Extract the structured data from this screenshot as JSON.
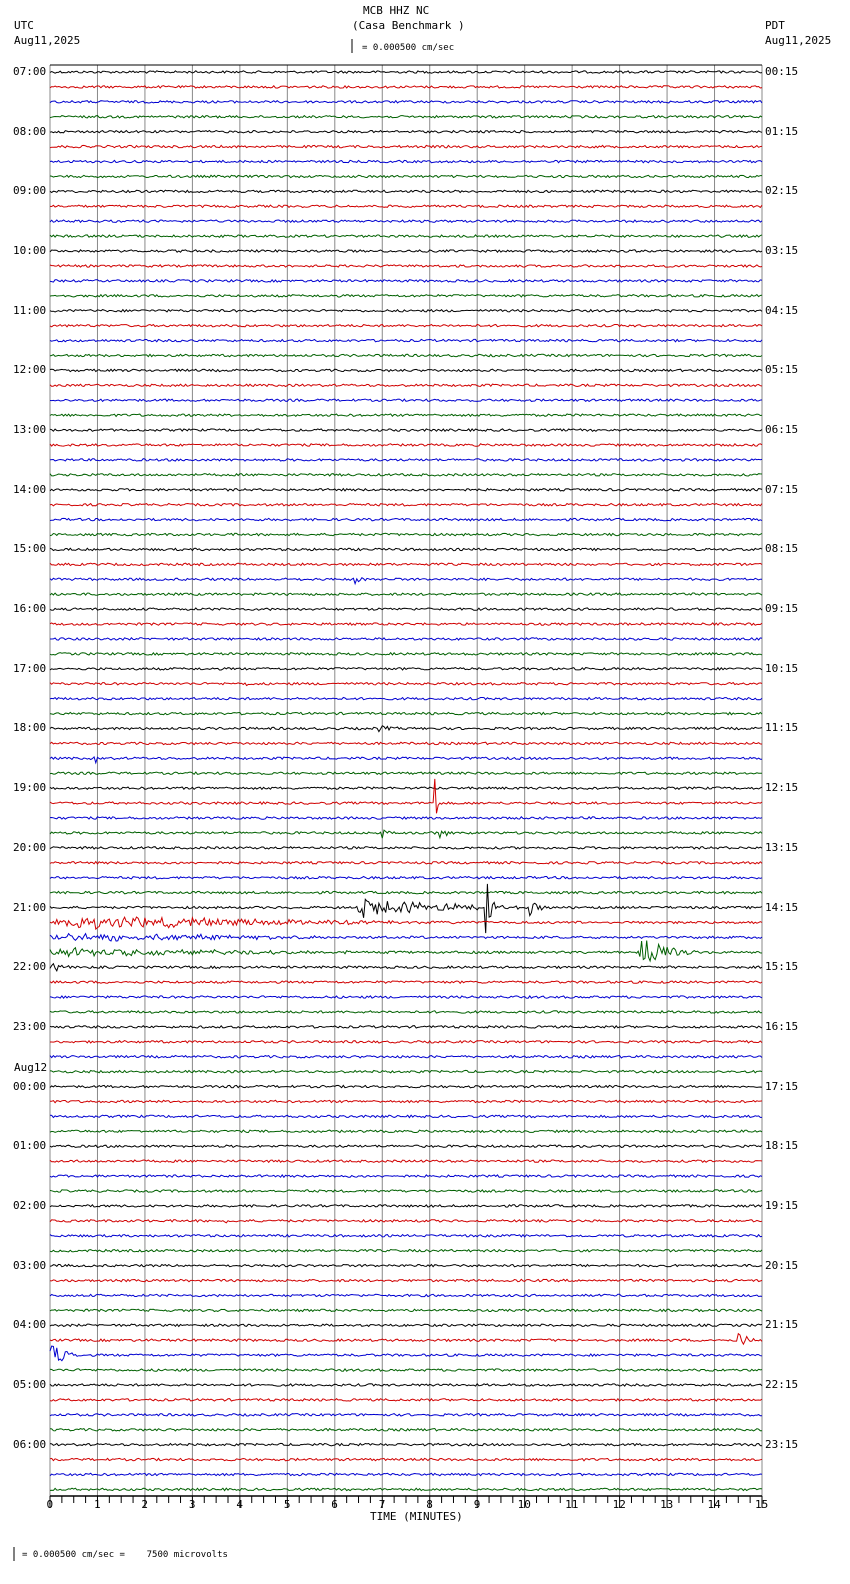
{
  "header": {
    "station": "MCB HHZ NC",
    "site": "(Casa Benchmark )",
    "scale": "= 0.000500 cm/sec",
    "left_tz": "UTC",
    "left_date": "Aug11,2025",
    "right_tz": "PDT",
    "right_date": "Aug11,2025",
    "date_change": "Aug12"
  },
  "footer": {
    "scale": "= 0.000500 cm/sec =    7500 microvolts"
  },
  "chart_data": {
    "type": "line",
    "title": "MCB HHZ NC (Casa Benchmark )",
    "xlabel": "TIME (MINUTES)",
    "xlim": [
      0,
      15
    ],
    "x_ticks": [
      "0",
      "1",
      "2",
      "3",
      "4",
      "5",
      "6",
      "7",
      "8",
      "9",
      "10",
      "11",
      "12",
      "13",
      "14",
      "15"
    ],
    "rows_per_hour": 4,
    "row_count": 96,
    "trace_colors": [
      "#000000",
      "#d00000",
      "#0000d0",
      "#006000"
    ],
    "utc_labels": [
      "07:00",
      "08:00",
      "09:00",
      "10:00",
      "11:00",
      "12:00",
      "13:00",
      "14:00",
      "15:00",
      "16:00",
      "17:00",
      "18:00",
      "19:00",
      "20:00",
      "21:00",
      "22:00",
      "23:00",
      "00:00",
      "01:00",
      "02:00",
      "03:00",
      "04:00",
      "05:00",
      "06:00"
    ],
    "pdt_labels": [
      "00:15",
      "01:15",
      "02:15",
      "03:15",
      "04:15",
      "05:15",
      "06:15",
      "07:15",
      "08:15",
      "09:15",
      "10:15",
      "11:15",
      "12:15",
      "13:15",
      "14:15",
      "15:15",
      "16:15",
      "17:15",
      "18:15",
      "19:15",
      "20:15",
      "21:15",
      "22:15",
      "23:15"
    ],
    "events": [
      {
        "row": 34,
        "start": 6.4,
        "end": 6.8,
        "amp": 0.9
      },
      {
        "row": 41,
        "start": 4.1,
        "end": 4.4,
        "amp": 0.3
      },
      {
        "row": 44,
        "start": 6.9,
        "end": 8.2,
        "amp": 0.3
      },
      {
        "row": 46,
        "start": 0.9,
        "end": 1.2,
        "amp": 0.7
      },
      {
        "row": 49,
        "start": 8.1,
        "end": 8.2,
        "amp": 5.5
      },
      {
        "row": 51,
        "start": 7.0,
        "end": 7.3,
        "amp": 0.6
      },
      {
        "row": 51,
        "start": 8.2,
        "end": 8.6,
        "amp": 0.8
      },
      {
        "row": 56,
        "start": 6.5,
        "end": 12.3,
        "amp": 0.8
      },
      {
        "row": 56,
        "start": 9.15,
        "end": 9.4,
        "amp": 5.0
      },
      {
        "row": 56,
        "start": 10.1,
        "end": 10.6,
        "amp": 1.2
      },
      {
        "row": 57,
        "start": 0.1,
        "end": 15,
        "amp": 0.6
      },
      {
        "row": 58,
        "start": 0,
        "end": 15,
        "amp": 0.4
      },
      {
        "row": 59,
        "start": 0,
        "end": 15,
        "amp": 0.4
      },
      {
        "row": 59,
        "start": 12.4,
        "end": 13.9,
        "amp": 2.0
      },
      {
        "row": 60,
        "start": 0,
        "end": 1.0,
        "amp": 0.4
      },
      {
        "row": 77,
        "start": 3.7,
        "end": 3.9,
        "amp": 0.3
      },
      {
        "row": 85,
        "start": 10.3,
        "end": 10.5,
        "amp": 0.5
      },
      {
        "row": 85,
        "start": 14.5,
        "end": 15,
        "amp": 1.0
      },
      {
        "row": 86,
        "start": 0,
        "end": 0.8,
        "amp": 1.2
      }
    ]
  }
}
